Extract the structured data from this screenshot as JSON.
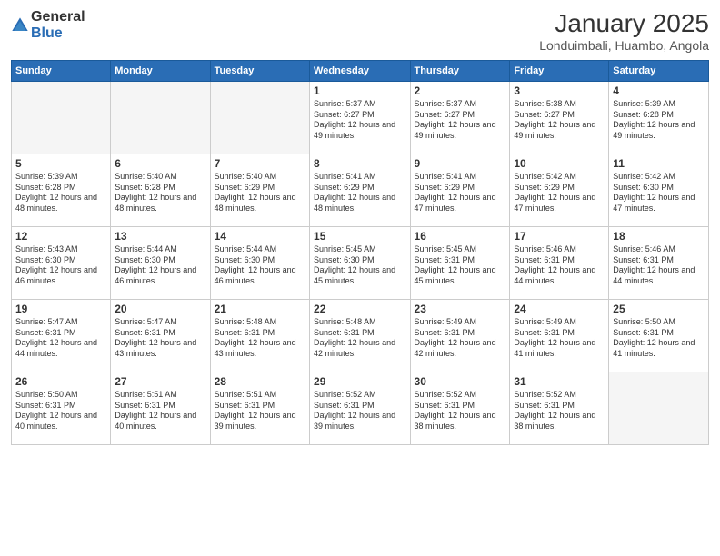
{
  "logo": {
    "general": "General",
    "blue": "Blue"
  },
  "header": {
    "title": "January 2025",
    "location": "Londuimbali, Huambo, Angola"
  },
  "weekdays": [
    "Sunday",
    "Monday",
    "Tuesday",
    "Wednesday",
    "Thursday",
    "Friday",
    "Saturday"
  ],
  "weeks": [
    [
      {
        "day": "",
        "empty": true
      },
      {
        "day": "",
        "empty": true
      },
      {
        "day": "",
        "empty": true
      },
      {
        "day": "1",
        "sunrise": "5:37 AM",
        "sunset": "6:27 PM",
        "daylight": "12 hours and 49 minutes."
      },
      {
        "day": "2",
        "sunrise": "5:37 AM",
        "sunset": "6:27 PM",
        "daylight": "12 hours and 49 minutes."
      },
      {
        "day": "3",
        "sunrise": "5:38 AM",
        "sunset": "6:27 PM",
        "daylight": "12 hours and 49 minutes."
      },
      {
        "day": "4",
        "sunrise": "5:39 AM",
        "sunset": "6:28 PM",
        "daylight": "12 hours and 49 minutes."
      }
    ],
    [
      {
        "day": "5",
        "sunrise": "5:39 AM",
        "sunset": "6:28 PM",
        "daylight": "12 hours and 48 minutes."
      },
      {
        "day": "6",
        "sunrise": "5:40 AM",
        "sunset": "6:28 PM",
        "daylight": "12 hours and 48 minutes."
      },
      {
        "day": "7",
        "sunrise": "5:40 AM",
        "sunset": "6:29 PM",
        "daylight": "12 hours and 48 minutes."
      },
      {
        "day": "8",
        "sunrise": "5:41 AM",
        "sunset": "6:29 PM",
        "daylight": "12 hours and 48 minutes."
      },
      {
        "day": "9",
        "sunrise": "5:41 AM",
        "sunset": "6:29 PM",
        "daylight": "12 hours and 47 minutes."
      },
      {
        "day": "10",
        "sunrise": "5:42 AM",
        "sunset": "6:29 PM",
        "daylight": "12 hours and 47 minutes."
      },
      {
        "day": "11",
        "sunrise": "5:42 AM",
        "sunset": "6:30 PM",
        "daylight": "12 hours and 47 minutes."
      }
    ],
    [
      {
        "day": "12",
        "sunrise": "5:43 AM",
        "sunset": "6:30 PM",
        "daylight": "12 hours and 46 minutes."
      },
      {
        "day": "13",
        "sunrise": "5:44 AM",
        "sunset": "6:30 PM",
        "daylight": "12 hours and 46 minutes."
      },
      {
        "day": "14",
        "sunrise": "5:44 AM",
        "sunset": "6:30 PM",
        "daylight": "12 hours and 46 minutes."
      },
      {
        "day": "15",
        "sunrise": "5:45 AM",
        "sunset": "6:30 PM",
        "daylight": "12 hours and 45 minutes."
      },
      {
        "day": "16",
        "sunrise": "5:45 AM",
        "sunset": "6:31 PM",
        "daylight": "12 hours and 45 minutes."
      },
      {
        "day": "17",
        "sunrise": "5:46 AM",
        "sunset": "6:31 PM",
        "daylight": "12 hours and 44 minutes."
      },
      {
        "day": "18",
        "sunrise": "5:46 AM",
        "sunset": "6:31 PM",
        "daylight": "12 hours and 44 minutes."
      }
    ],
    [
      {
        "day": "19",
        "sunrise": "5:47 AM",
        "sunset": "6:31 PM",
        "daylight": "12 hours and 44 minutes."
      },
      {
        "day": "20",
        "sunrise": "5:47 AM",
        "sunset": "6:31 PM",
        "daylight": "12 hours and 43 minutes."
      },
      {
        "day": "21",
        "sunrise": "5:48 AM",
        "sunset": "6:31 PM",
        "daylight": "12 hours and 43 minutes."
      },
      {
        "day": "22",
        "sunrise": "5:48 AM",
        "sunset": "6:31 PM",
        "daylight": "12 hours and 42 minutes."
      },
      {
        "day": "23",
        "sunrise": "5:49 AM",
        "sunset": "6:31 PM",
        "daylight": "12 hours and 42 minutes."
      },
      {
        "day": "24",
        "sunrise": "5:49 AM",
        "sunset": "6:31 PM",
        "daylight": "12 hours and 41 minutes."
      },
      {
        "day": "25",
        "sunrise": "5:50 AM",
        "sunset": "6:31 PM",
        "daylight": "12 hours and 41 minutes."
      }
    ],
    [
      {
        "day": "26",
        "sunrise": "5:50 AM",
        "sunset": "6:31 PM",
        "daylight": "12 hours and 40 minutes."
      },
      {
        "day": "27",
        "sunrise": "5:51 AM",
        "sunset": "6:31 PM",
        "daylight": "12 hours and 40 minutes."
      },
      {
        "day": "28",
        "sunrise": "5:51 AM",
        "sunset": "6:31 PM",
        "daylight": "12 hours and 39 minutes."
      },
      {
        "day": "29",
        "sunrise": "5:52 AM",
        "sunset": "6:31 PM",
        "daylight": "12 hours and 39 minutes."
      },
      {
        "day": "30",
        "sunrise": "5:52 AM",
        "sunset": "6:31 PM",
        "daylight": "12 hours and 38 minutes."
      },
      {
        "day": "31",
        "sunrise": "5:52 AM",
        "sunset": "6:31 PM",
        "daylight": "12 hours and 38 minutes."
      },
      {
        "day": "",
        "empty": true
      }
    ]
  ]
}
